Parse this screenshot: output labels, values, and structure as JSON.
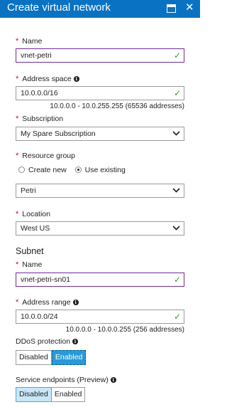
{
  "header": {
    "title": "Create virtual network"
  },
  "form": {
    "name": {
      "label": "Name",
      "value": "vnet-petri"
    },
    "address_space": {
      "label": "Address space",
      "value": "10.0.0.0/16",
      "hint": "10.0.0.0 - 10.0.255.255 (65536 addresses)"
    },
    "subscription": {
      "label": "Subscription",
      "value": "My Spare Subscription"
    },
    "resource_group": {
      "label": "Resource group",
      "options": [
        "Create new",
        "Use existing"
      ],
      "selected": "Use existing",
      "value": "Petri"
    },
    "location": {
      "label": "Location",
      "value": "West US"
    }
  },
  "subnet": {
    "title": "Subnet",
    "name": {
      "label": "Name",
      "value": "vnet-petri-sn01"
    },
    "address_range": {
      "label": "Address range",
      "value": "10.0.0.0/24",
      "hint": "10.0.0.0 - 10.0.0.255 (256 addresses)"
    }
  },
  "ddos": {
    "label": "DDoS protection",
    "options": [
      "Disabled",
      "Enabled"
    ],
    "selected": "Enabled"
  },
  "service_endpoints": {
    "label": "Service endpoints (Preview)",
    "options": [
      "Disabled",
      "Enabled"
    ],
    "selected": "Disabled"
  },
  "symbols": {
    "required": "*",
    "info": "i",
    "check": "✓",
    "close": "✕"
  },
  "colors": {
    "header_bg": "#0a72c2",
    "required": "#c50f1f",
    "valid_check": "#3a9a24",
    "toggle_selected": "#2a9ad6",
    "toggle_selected_light": "#c8e8f8"
  }
}
